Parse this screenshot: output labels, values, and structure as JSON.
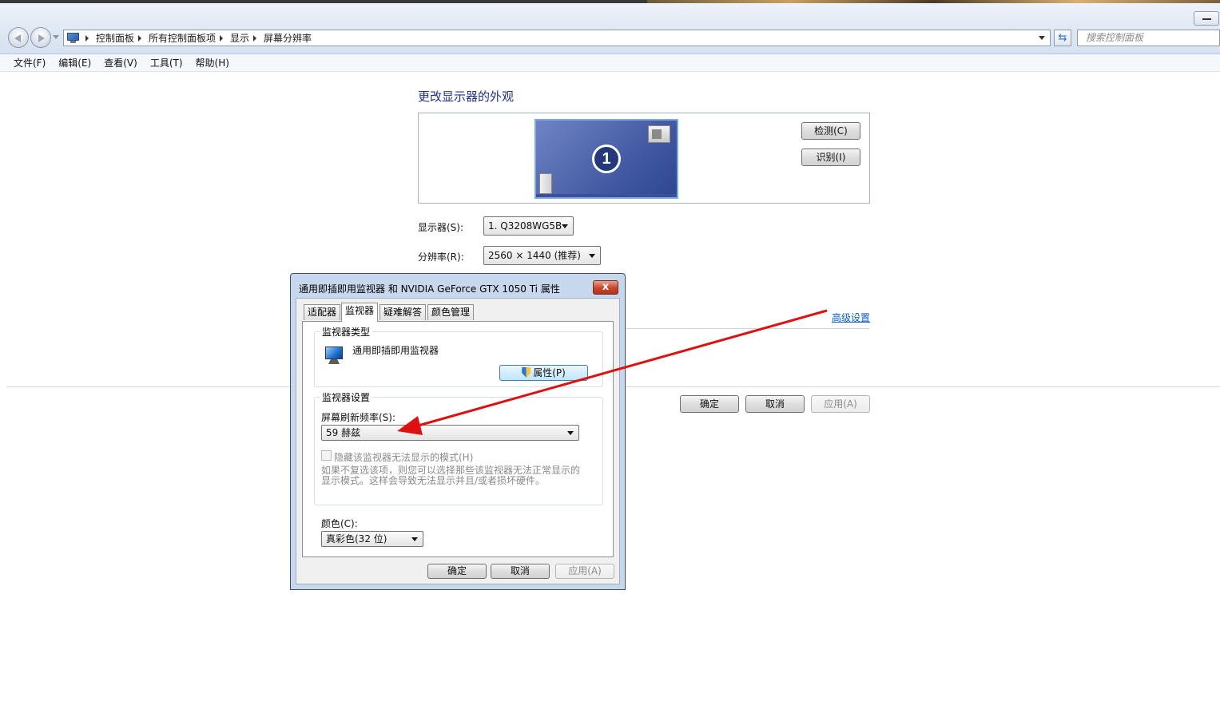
{
  "breadcrumb": [
    "控制面板",
    "所有控制面板项",
    "显示",
    "屏幕分辨率"
  ],
  "search": {
    "placeholder": "搜索控制面板"
  },
  "menu": [
    "文件(F)",
    "编辑(E)",
    "查看(V)",
    "工具(T)",
    "帮助(H)"
  ],
  "main": {
    "heading": "更改显示器的外观",
    "monitor_number": "1",
    "detect_label": "检测(C)",
    "identify_label": "识别(I)",
    "display_label": "显示器(S):",
    "display_value": "1. Q3208WG5B",
    "resolution_label": "分辨率(R):",
    "resolution_value": "2560 × 1440 (推荐)",
    "advanced_link": "高级设置",
    "ok_label": "确定",
    "cancel_label": "取消",
    "apply_label": "应用(A)"
  },
  "dialog": {
    "title": "通用即插即用监视器 和 NVIDIA GeForce GTX 1050 Ti 属性",
    "close_glyph": "x",
    "tabs": [
      "适配器",
      "监视器",
      "疑难解答",
      "颜色管理"
    ],
    "monitor_type_group": "监视器类型",
    "monitor_type_value": "通用即插即用监视器",
    "properties_label": "属性(P)",
    "monitor_settings_group": "监视器设置",
    "refresh_label": "屏幕刷新频率(S):",
    "refresh_value": "59 赫兹",
    "hide_modes_label": "隐藏该监视器无法显示的模式(H)",
    "hide_modes_desc_1": "如果不复选该项，则您可以选择那些该监视器无法正常显示的",
    "hide_modes_desc_2": "显示模式。这样会导致无法显示并且/或者损坏硬件。",
    "color_label": "颜色(C):",
    "color_value": "真彩色(32 位)",
    "ok_label": "确定",
    "cancel_label": "取消",
    "apply_label": "应用(A)"
  },
  "annotation": {
    "arrow_color": "#e01010"
  }
}
